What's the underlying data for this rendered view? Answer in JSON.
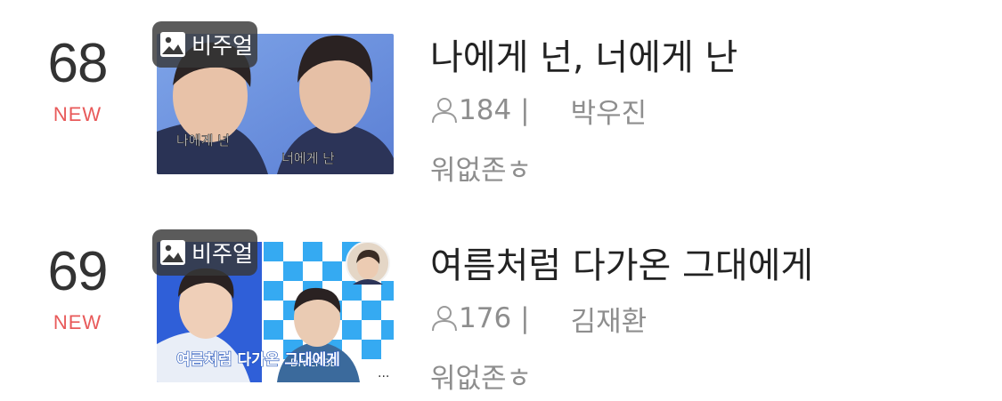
{
  "items": [
    {
      "rank": "68",
      "status": "NEW",
      "badge_label": "비주얼",
      "title": "나에게 넌, 너에게 난",
      "views": "184",
      "separator": "|",
      "author": "박우진",
      "tag": "워없존ㅎ",
      "thumb_text_left": "나에게 넌",
      "thumb_text_right": "너에게 난"
    },
    {
      "rank": "69",
      "status": "NEW",
      "badge_label": "비주얼",
      "title": "여름처럼 다가온 그대에게",
      "views": "176",
      "separator": "|",
      "author": "김재환",
      "tag": "워없존ㅎ",
      "thumb_caption": "여름처럼 다가온 그대에게",
      "thumb_shirt_text": "DIVERSE",
      "thumb_more": "..."
    }
  ],
  "colors": {
    "new": "#e85a5a",
    "meta": "#8e8e8e",
    "title": "#222222",
    "rank": "#333333"
  }
}
